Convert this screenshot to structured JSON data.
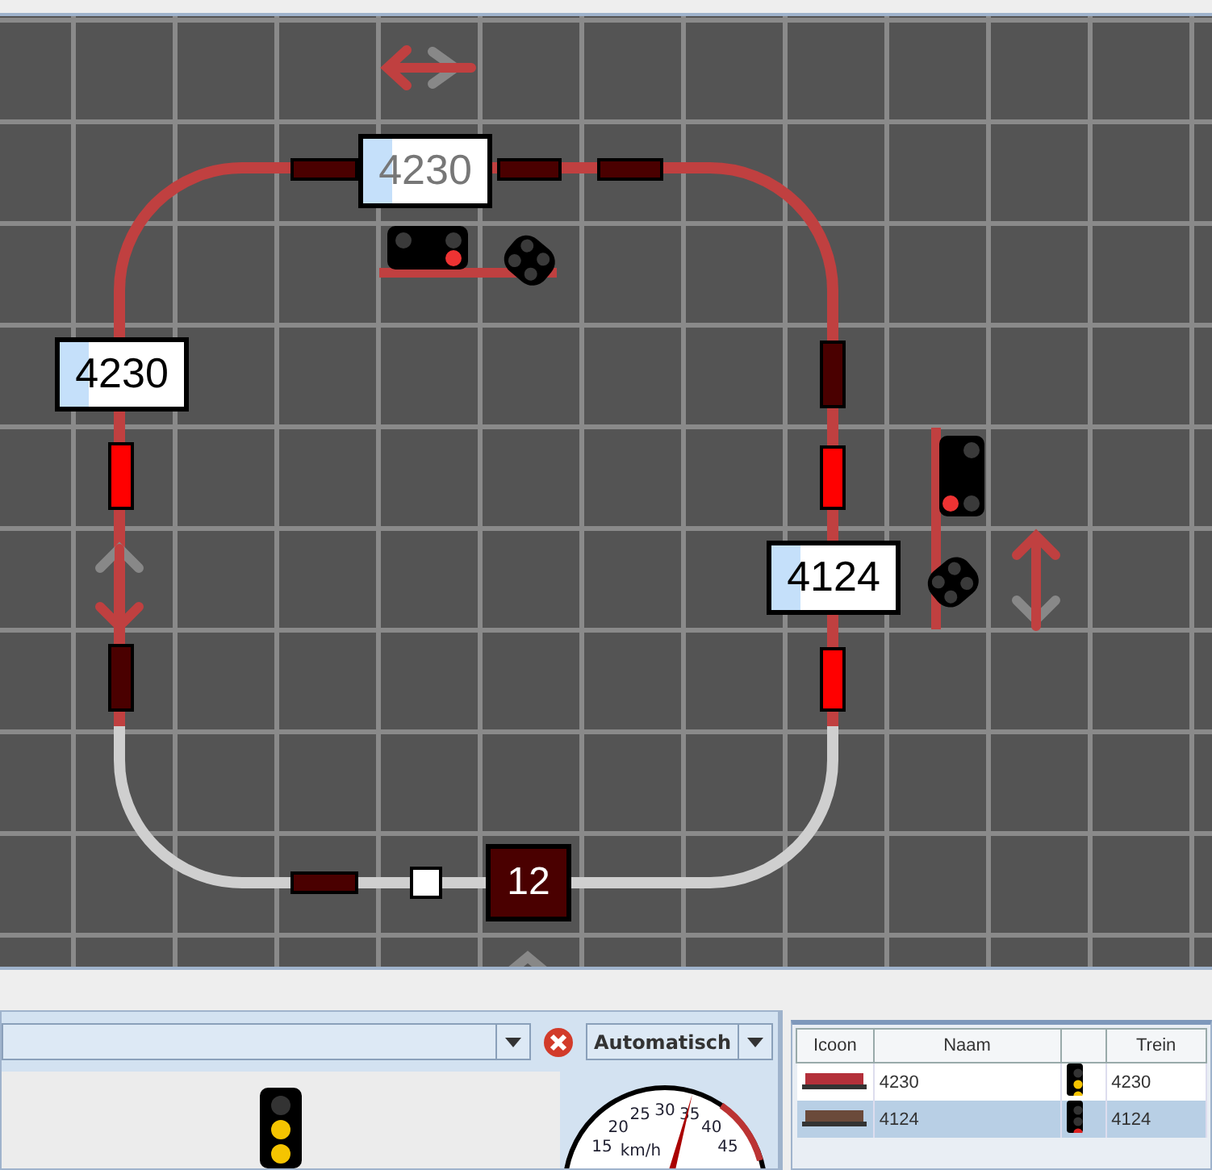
{
  "layout": {
    "track_sections": [
      {
        "reserved": true
      },
      {
        "reserved": false
      }
    ],
    "blocks": [
      {
        "occupied": false
      },
      {
        "occupied": false
      },
      {
        "occupied": false
      },
      {
        "occupied": true
      },
      {
        "occupied": false
      },
      {
        "occupied": false
      },
      {
        "occupied": true
      },
      {
        "occupied": true
      },
      {
        "occupied": false
      }
    ],
    "train_labels": [
      {
        "text": "4230",
        "dimmed": true
      },
      {
        "text": "4230",
        "dimmed": false
      },
      {
        "text": "4124",
        "dimmed": false
      }
    ],
    "block_number": "12",
    "signals": [
      {
        "stop": true
      },
      {
        "stop": true
      }
    ]
  },
  "control_panel": {
    "mode_select": {
      "value": "Automatisch"
    },
    "signal": {
      "stop": false
    },
    "speedometer": {
      "unit": "km/h",
      "ticks": [
        "15",
        "20",
        "25",
        "30",
        "35",
        "40",
        "45"
      ]
    }
  },
  "train_table": {
    "columns": [
      "Icoon",
      "Naam",
      "",
      "Trein"
    ],
    "rows": [
      {
        "name": "4230",
        "train": "4230",
        "stop": false,
        "selected": false
      },
      {
        "name": "4124",
        "train": "4124",
        "stop": true,
        "selected": true
      }
    ]
  }
}
